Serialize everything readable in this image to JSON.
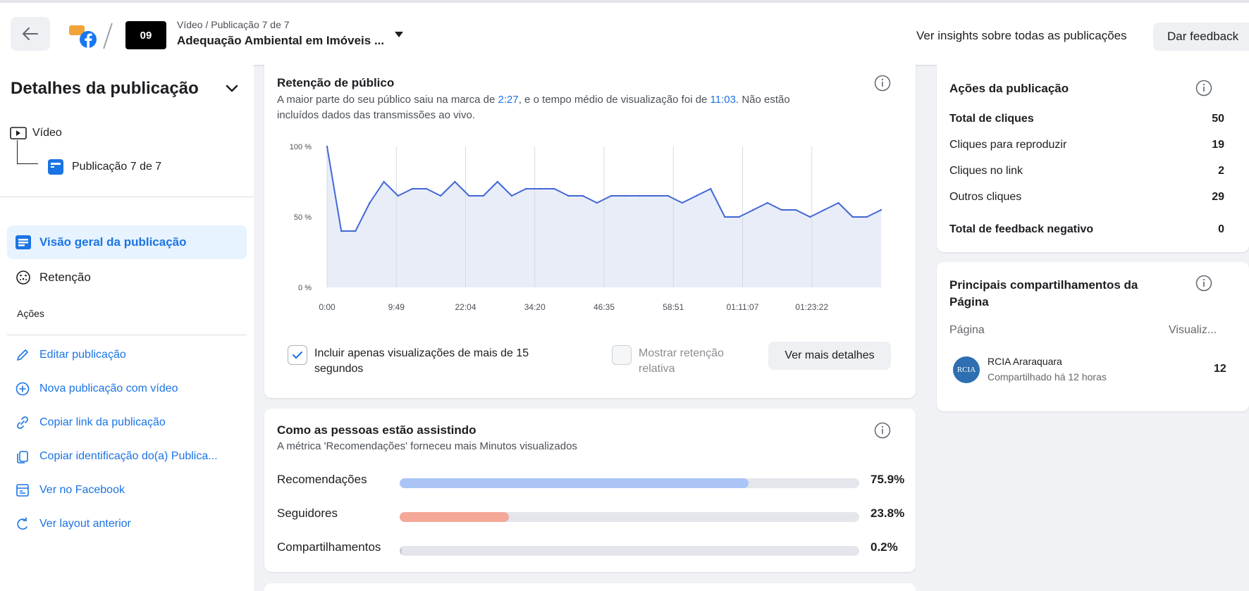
{
  "header": {
    "crumb": "Vídeo / Publicação 7 de 7",
    "post_title": "Adequação Ambiental em Imóveis ...",
    "thumb_label": "09",
    "insights_link": "Ver insights sobre todas as publicações",
    "feedback_button": "Dar feedback"
  },
  "sidebar": {
    "title": "Detalhes da publicação",
    "tree": {
      "video": "Vídeo",
      "post": "Publicação 7 de 7"
    },
    "nav": [
      {
        "label": "Visão geral da publicação",
        "icon": "overview-icon",
        "active": true
      },
      {
        "label": "Retenção",
        "icon": "retention-icon",
        "active": false
      }
    ],
    "actions_label": "Ações",
    "actions": [
      {
        "label": "Editar publicação",
        "icon": "pencil-icon"
      },
      {
        "label": "Nova publicação com vídeo",
        "icon": "plus-circle-icon"
      },
      {
        "label": "Copiar link da publicação",
        "icon": "link-icon"
      },
      {
        "label": "Copiar identificação do(a) Publica...",
        "icon": "copy-icon"
      },
      {
        "label": "Ver no Facebook",
        "icon": "facebook-page-icon"
      },
      {
        "label": "Ver layout anterior",
        "icon": "refresh-icon"
      }
    ]
  },
  "retention": {
    "title": "Retenção de público",
    "desc_prefix": "A maior parte do seu público saiu na marca de ",
    "drop_time": "2:27",
    "desc_mid": ", e o tempo médio de visualização foi de ",
    "avg_time": "11:03",
    "desc_suffix": ". Não estão",
    "desc_line2": "incluídos dados das transmissões ao vivo.",
    "checkbox1_label": "Incluir apenas visualizações de mais de 15 segundos",
    "checkbox1_checked": true,
    "checkbox2_label": "Mostrar retenção relativa",
    "checkbox2_checked": false,
    "details_button": "Ver mais detalhes"
  },
  "chart_data": {
    "type": "area",
    "ylim": [
      0,
      100
    ],
    "y_ticks": [
      "0 %",
      "50 %",
      "100 %"
    ],
    "x_ticks": [
      "0:00",
      "9:49",
      "22:04",
      "34:20",
      "46:35",
      "58:51",
      "01:11:07",
      "01:23:22"
    ],
    "color": "#4267d6",
    "fill": "#e8edf8",
    "series": [
      {
        "values": [
          100,
          40,
          40,
          60,
          75,
          65,
          70,
          70,
          65,
          75,
          65,
          65,
          75,
          65,
          70,
          70,
          70,
          65,
          65,
          60,
          65,
          65,
          65,
          65,
          65,
          60,
          65,
          70,
          50,
          50,
          55,
          60,
          55,
          55,
          50,
          55,
          60,
          50,
          50,
          55
        ]
      }
    ]
  },
  "watching": {
    "title": "Como as pessoas estão assistindo",
    "desc": "A métrica 'Recomendações' forneceu mais Minutos visualizados",
    "rows": [
      {
        "label": "Recomendações",
        "value": 75.9,
        "pct": "75.9%",
        "color": "#aac4f6"
      },
      {
        "label": "Seguidores",
        "value": 23.8,
        "pct": "23.8%",
        "color": "#f4a898"
      },
      {
        "label": "Compartilhamentos",
        "value": 0.2,
        "pct": "0.2%",
        "color": "#c9ccd1"
      }
    ]
  },
  "post_actions": {
    "title": "Ações da publicação",
    "rows": [
      {
        "label": "Total de cliques",
        "value": "50",
        "bold": true
      },
      {
        "label": "Cliques para reproduzir",
        "value": "19",
        "bold": false
      },
      {
        "label": "Cliques no link",
        "value": "2",
        "bold": false
      },
      {
        "label": "Outros cliques",
        "value": "29",
        "bold": false
      },
      {
        "label": "Total de feedback negativo",
        "value": "0",
        "bold": true
      }
    ]
  },
  "shares": {
    "title_line1": "Principais compartilhamentos da",
    "title_line2": "Página",
    "col_page": "Página",
    "col_views": "Visualiz...",
    "avatar_text": "RCIA",
    "page_name": "RCIA Araraquara",
    "shared_time": "Compartilhado há 12 horas",
    "views": "12"
  }
}
